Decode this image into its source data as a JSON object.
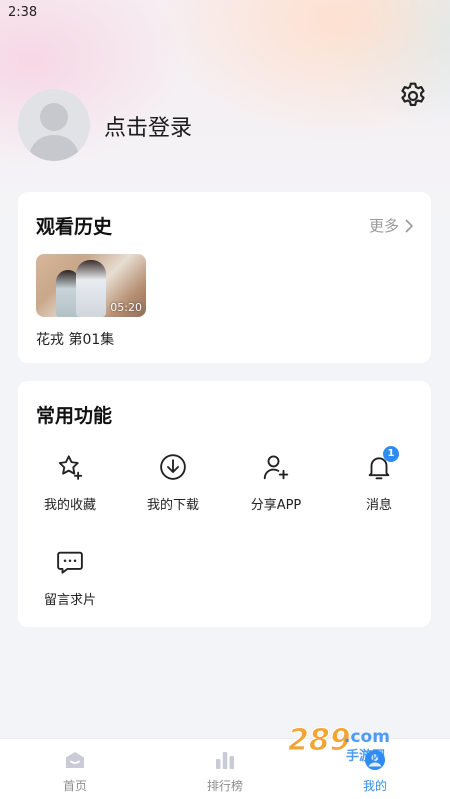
{
  "status_bar": {
    "time": "2:38"
  },
  "profile": {
    "login_text": "点击登录",
    "avatar_icon": "default-avatar-icon",
    "settings_icon": "gear-icon"
  },
  "history": {
    "title": "观看历史",
    "more_label": "更多",
    "items": [
      {
        "title": "花戎 第01集",
        "duration": "05:20"
      }
    ]
  },
  "functions": {
    "title": "常用功能",
    "items": [
      {
        "label": "我的收藏",
        "icon": "star-icon"
      },
      {
        "label": "我的下载",
        "icon": "download-icon"
      },
      {
        "label": "分享APP",
        "icon": "add-user-icon"
      },
      {
        "label": "消息",
        "icon": "bell-icon",
        "badge": "1"
      },
      {
        "label": "留言求片",
        "icon": "message-icon"
      }
    ]
  },
  "bottom_nav": {
    "items": [
      {
        "label": "首页",
        "icon": "home-icon"
      },
      {
        "label": "排行榜",
        "icon": "ranking-icon"
      },
      {
        "label": "我的",
        "icon": "profile-icon",
        "active": true
      }
    ]
  },
  "watermark": {
    "text": "289.com",
    "subtext": "手游网"
  },
  "colors": {
    "accent": "#2f8cf5",
    "card": "#ffffff",
    "background": "#f3f4f7"
  }
}
